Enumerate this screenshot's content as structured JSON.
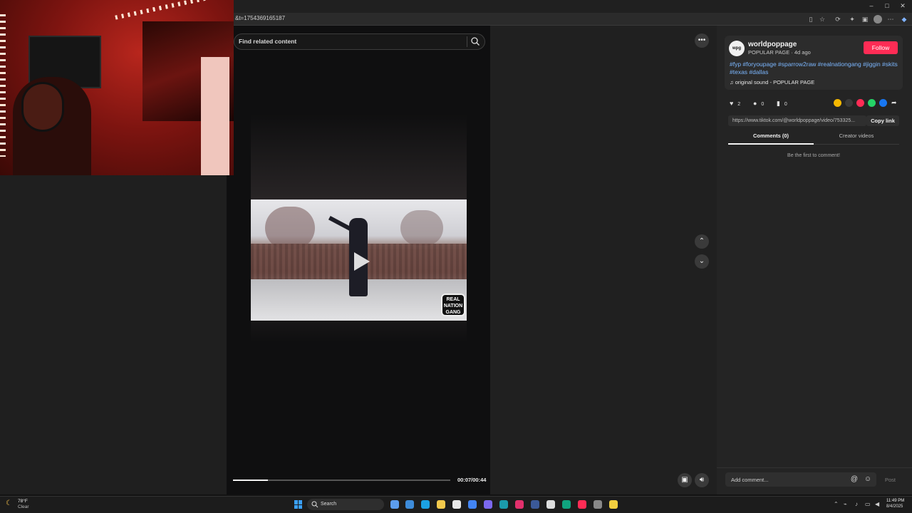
{
  "browser": {
    "url": "&t=1754369165187",
    "window_controls": [
      "–",
      "□",
      "✕"
    ]
  },
  "feed": {
    "search_placeholder": "Find related content",
    "progress_fraction": 0.16,
    "time": "00:07/00:44",
    "watermark": "REAL NATION GANG"
  },
  "post": {
    "username": "worldpoppage",
    "avatar_text": "wpg",
    "subline": "POPULAR PAGE · 4d ago",
    "follow_label": "Follow",
    "hashtags": "#fyp #foryoupage #sparrow2raw #realnationgang #jiggin #skits #texas #dallas",
    "sound": "original sound - POPULAR PAGE",
    "likes": "2",
    "comments": "0",
    "saves": "0",
    "link": "https://www.tiktok.com/@worldpoppage/video/753325...",
    "copy_link_label": "Copy link",
    "tabs": {
      "comments": "Comments (0)",
      "creator": "Creator videos"
    },
    "empty_comments": "Be the first to comment!",
    "comment_placeholder": "Add comment...",
    "post_label": "Post",
    "share_colors": [
      "#f5b800",
      "#3a3a3a",
      "#fe2c55",
      "#25d366",
      "#1877f2"
    ]
  },
  "taskbar": {
    "weather_temp": "78°F",
    "weather_cond": "Clear",
    "search_label": "Search",
    "clock_time": "11:49 PM",
    "clock_date": "8/4/2025",
    "app_colors": [
      "#5c9ded",
      "#3d8bd9",
      "#1ba1e2",
      "#f2c94c",
      "#e9e9e9",
      "#4285f4",
      "#7b68ee",
      "#1b9aaa",
      "#e1306c",
      "#3b5998",
      "#dddddd",
      "#10a37f",
      "#fe2c55",
      "#888888",
      "#f4d03f"
    ]
  }
}
